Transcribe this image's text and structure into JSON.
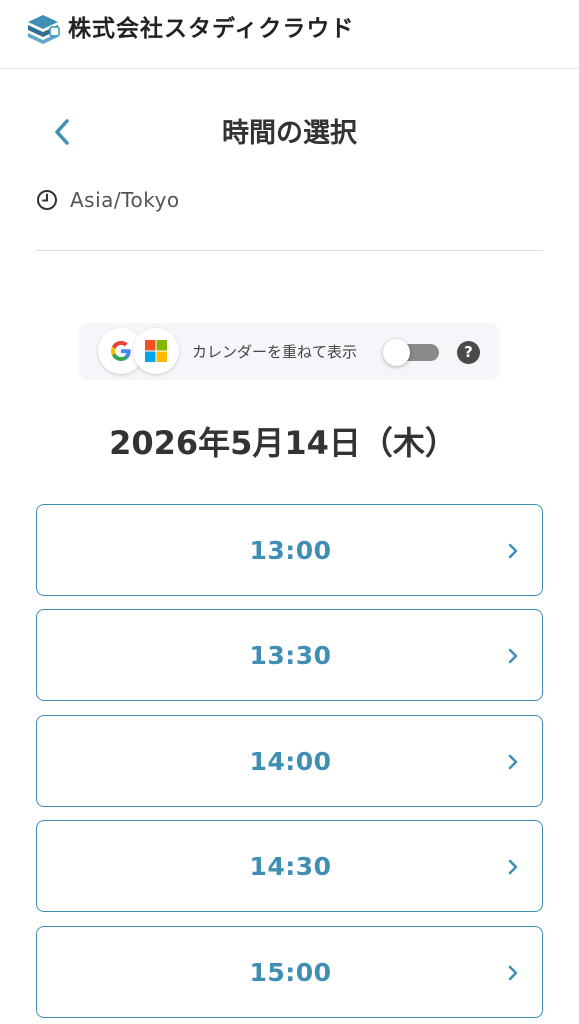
{
  "header": {
    "company_name": "株式会社スタディクラウド",
    "logo_icon": "stacked-books-logo"
  },
  "page": {
    "title": "時間の選択",
    "back_icon": "chevron-left-icon",
    "timezone": "Asia/Tokyo",
    "timezone_icon": "clock-icon"
  },
  "calendar_overlay": {
    "label": "カレンダーを重ねて表示",
    "google_icon": "google-icon",
    "microsoft_icon": "microsoft-icon",
    "toggle_on": false,
    "help_glyph": "?"
  },
  "schedule": {
    "date": "2026年5月14日（木）",
    "slots": [
      {
        "time": "13:00"
      },
      {
        "time": "13:30"
      },
      {
        "time": "14:00"
      },
      {
        "time": "14:30"
      },
      {
        "time": "15:00"
      }
    ]
  },
  "colors": {
    "accent": "#3f8fb5",
    "toggle_off": "#8a8a8a"
  }
}
